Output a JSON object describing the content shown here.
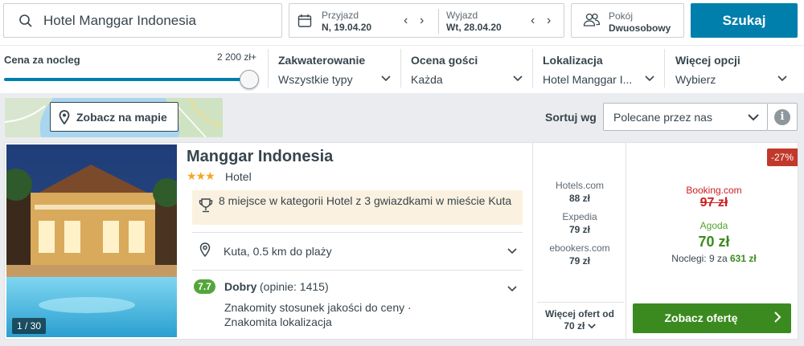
{
  "search": {
    "query": "Hotel Manggar Indonesia",
    "button_label": "Szukaj"
  },
  "dates": {
    "checkin_label": "Przyjazd",
    "checkin_value": "N, 19.04.20",
    "checkout_label": "Wyjazd",
    "checkout_value": "Wt, 28.04.20"
  },
  "rooms": {
    "label": "Pokój",
    "value": "Dwuosobowy"
  },
  "filters": {
    "price_label": "Cena za nocleg",
    "price_max": "2 200 zł+",
    "items": [
      {
        "title": "Zakwaterowanie",
        "value": "Wszystkie typy"
      },
      {
        "title": "Ocena gości",
        "value": "Każda"
      },
      {
        "title": "Lokalizacja",
        "value": "Hotel Manggar I..."
      },
      {
        "title": "Więcej opcji",
        "value": "Wybierz"
      }
    ]
  },
  "map": {
    "button_label": "Zobacz na mapie"
  },
  "sort": {
    "label": "Sortuj wg",
    "value": "Polecane przez nas"
  },
  "hotel": {
    "name": "Manggar Indonesia",
    "stars": "★★★",
    "type": "Hotel",
    "photo_counter": "1 / 30",
    "award_text": "8 miejsce w kategorii Hotel z 3 gwiazdkami w mieście Kuta",
    "location": "Kuta, 0.5 km do plaży",
    "rating": "7.7",
    "rating_word": "Dobry",
    "rating_count": "(opinie: 1415)",
    "rating_desc": "Znakomity stosunek jakości do ceny · Znakomita lokalizacja"
  },
  "offers": [
    {
      "source": "Hotels.com",
      "price": "88 zł"
    },
    {
      "source": "Expedia",
      "price": "79 zł"
    },
    {
      "source": "ebookers.com",
      "price": "79 zł"
    }
  ],
  "more_offers": {
    "label": "Więcej ofert od",
    "price": "70 zł"
  },
  "best_deal": {
    "discount": "-27%",
    "crossed_source": "Booking.com",
    "crossed_price": "97 zł",
    "deal_source": "Agoda",
    "deal_price": "70 zł",
    "nights_text": "Noclegi: 9 za",
    "nights_total": "631 zł",
    "cta_label": "Zobacz ofertę"
  },
  "colors": {
    "accent_blue": "#007fad",
    "deal_green": "#3b8a1f",
    "strike_red": "#cc1f1f",
    "rating_green": "#54a63b"
  }
}
